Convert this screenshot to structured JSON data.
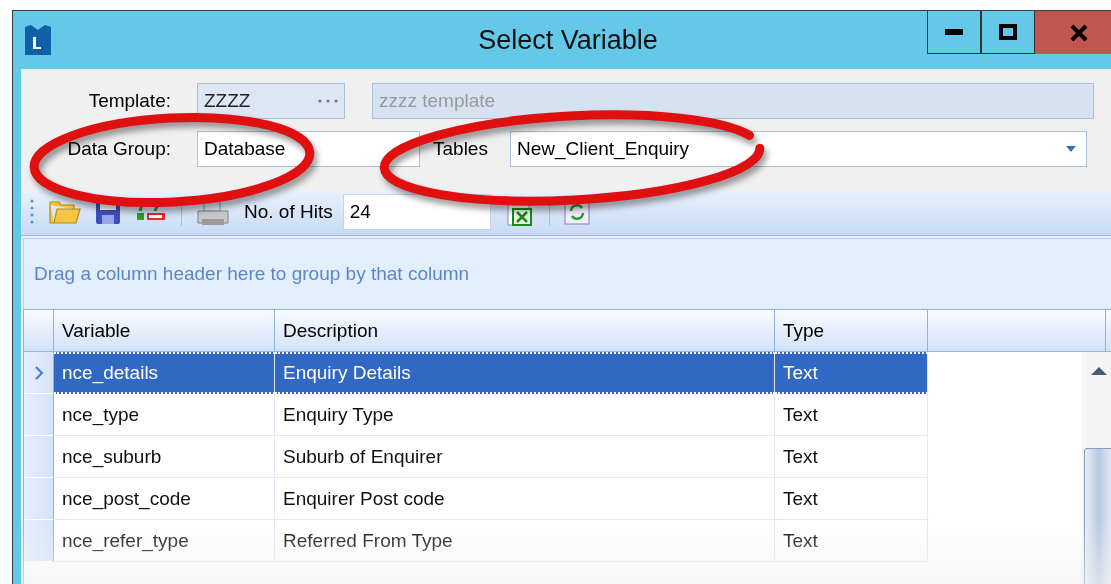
{
  "window": {
    "title": "Select Variable"
  },
  "template": {
    "label": "Template:",
    "value": "ZZZZ",
    "description": "zzzz template"
  },
  "data_group": {
    "label": "Data Group:",
    "value": "Database"
  },
  "tables": {
    "label": "Tables",
    "value": "New_Client_Enquiry"
  },
  "toolbar": {
    "hits_label": "No. of Hits",
    "hits": "24"
  },
  "group_panel": {
    "hint": "Drag a column header here to group by that column"
  },
  "table": {
    "columns": [
      "Variable",
      "Description",
      "Type"
    ],
    "rows": [
      {
        "cells": [
          "nce_details",
          "Enquiry Details",
          "Text"
        ],
        "selected": true
      },
      {
        "cells": [
          "nce_type",
          "Enquiry Type",
          "Text"
        ],
        "selected": false
      },
      {
        "cells": [
          "nce_suburb",
          "Suburb of Enquirer",
          "Text"
        ],
        "selected": false
      },
      {
        "cells": [
          "nce_post_code",
          "Enquirer Post code",
          "Text"
        ],
        "selected": false
      },
      {
        "cells": [
          "nce_refer_type",
          "Referred From Type",
          "Text"
        ],
        "selected": false
      }
    ]
  },
  "annotations": [
    {
      "kind": "ellipse"
    },
    {
      "kind": "ellipse"
    }
  ]
}
